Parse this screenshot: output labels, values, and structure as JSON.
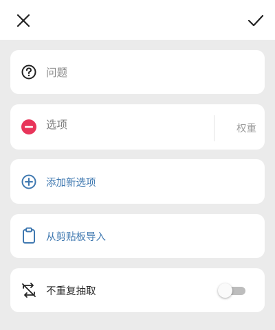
{
  "header": {
    "close_icon": "close-icon",
    "confirm_icon": "check-icon"
  },
  "question": {
    "icon": "question-circle-icon",
    "placeholder": "问题"
  },
  "option": {
    "icon": "remove-circle-icon",
    "icon_color": "#e8355a",
    "placeholder": "选项",
    "weight_label": "权重"
  },
  "add_option": {
    "icon": "add-circle-icon",
    "label": "添加新选项",
    "color": "#3f78b0"
  },
  "paste_import": {
    "icon": "clipboard-icon",
    "label": "从剪贴板导入",
    "color": "#3f78b0"
  },
  "no_repeat": {
    "icon": "no-repeat-icon",
    "label": "不重复抽取",
    "enabled": false
  }
}
